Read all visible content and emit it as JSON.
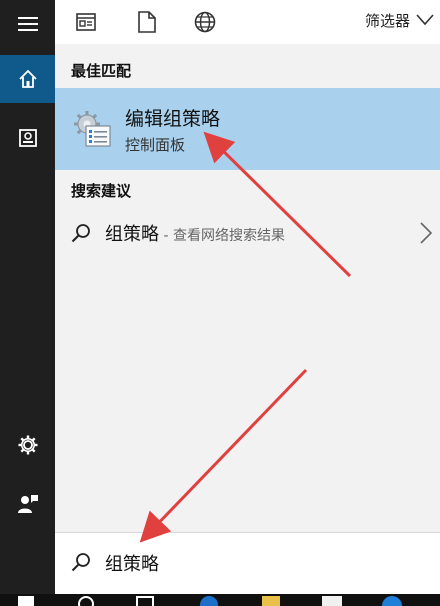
{
  "filter": {
    "label": "筛选器"
  },
  "best_match": {
    "section_label": "最佳匹配",
    "title": "编辑组策略",
    "subtitle": "控制面板"
  },
  "suggestions": {
    "section_label": "搜索建议",
    "items": [
      {
        "term": "组策略",
        "hint": " - 查看网络搜索结果"
      }
    ]
  },
  "search": {
    "query": "组策略"
  },
  "colors": {
    "rail": "#1f1f1f",
    "rail_active": "#0f5a8a",
    "highlight": "#a9d1ee",
    "arrow": "#e0413f"
  }
}
